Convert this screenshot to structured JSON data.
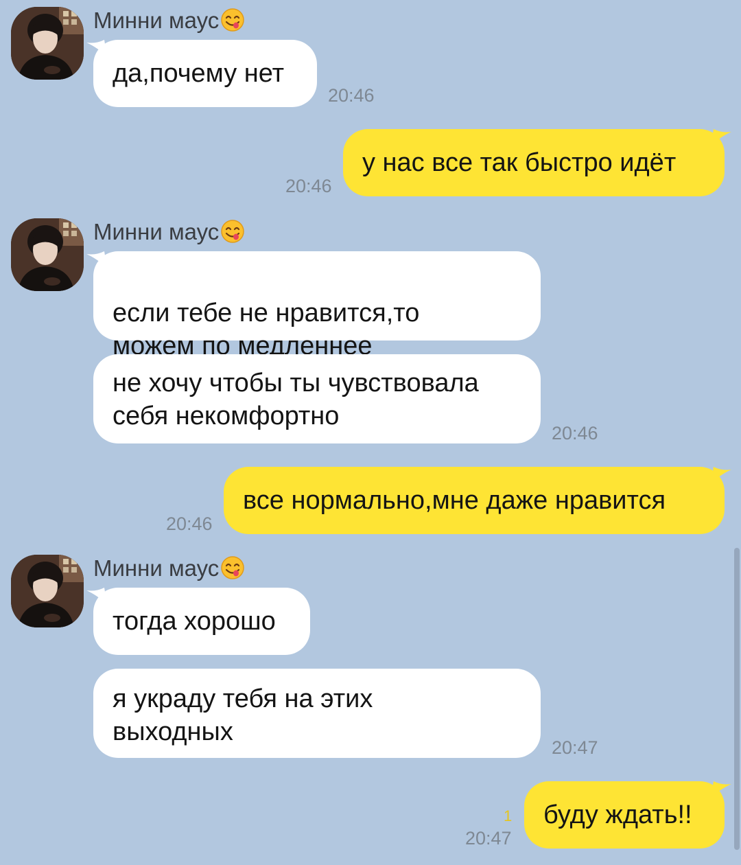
{
  "chat": {
    "groups": [
      {
        "sender": "Минни маус",
        "messages": [
          "да,почему нет"
        ],
        "time": "20:46"
      },
      {
        "outgoing": true,
        "messages": [
          "у нас все так быстро идёт"
        ],
        "time": "20:46"
      },
      {
        "sender": "Минни маус",
        "messages": [
          "если тебе не нравится,то\nможем по медленнее",
          "не хочу чтобы ты чувствовала\nсебя некомфортно"
        ],
        "time": "20:46"
      },
      {
        "outgoing": true,
        "messages": [
          "все нормально,мне даже нравится"
        ],
        "time": "20:46"
      },
      {
        "sender": "Минни маус",
        "messages": [
          "тогда хорошо",
          "я украду тебя на этих\nвыходных"
        ],
        "time": "20:47"
      },
      {
        "outgoing": true,
        "messages": [
          "буду ждать!!"
        ],
        "time": "20:47",
        "unread_count": "1"
      }
    ]
  },
  "icons": {
    "sender_emoji": "smiling-face-savoring-food-emoji",
    "avatar": "user-avatar-photo"
  },
  "colors": {
    "background": "#b2c7df",
    "incoming_bubble": "#ffffff",
    "outgoing_bubble": "#fee434",
    "timestamp": "#7e8893",
    "unread_counter": "#e6c51c"
  }
}
